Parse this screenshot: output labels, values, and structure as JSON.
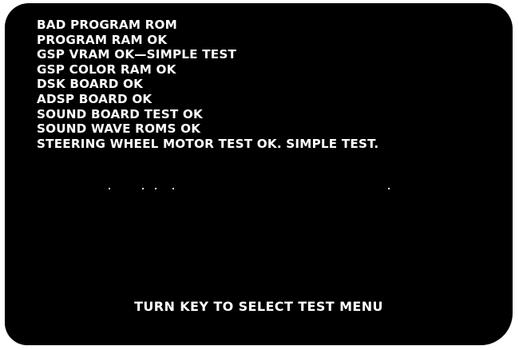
{
  "screen": {
    "status_lines": [
      "BAD PROGRAM ROM",
      "PROGRAM RAM OK",
      "GSP VRAM OK—SIMPLE TEST",
      "GSP COLOR RAM OK",
      "DSK BOARD OK",
      "ADSP BOARD OK",
      "SOUND BOARD TEST OK",
      "SOUND WAVE ROMS OK",
      "STEERING WHEEL MOTOR TEST OK.  SIMPLE TEST."
    ],
    "prompt": "TURN KEY TO SELECT TEST MENU"
  },
  "colors": {
    "background": "#000000",
    "text": "#ffffff",
    "page": "#ffffff"
  }
}
